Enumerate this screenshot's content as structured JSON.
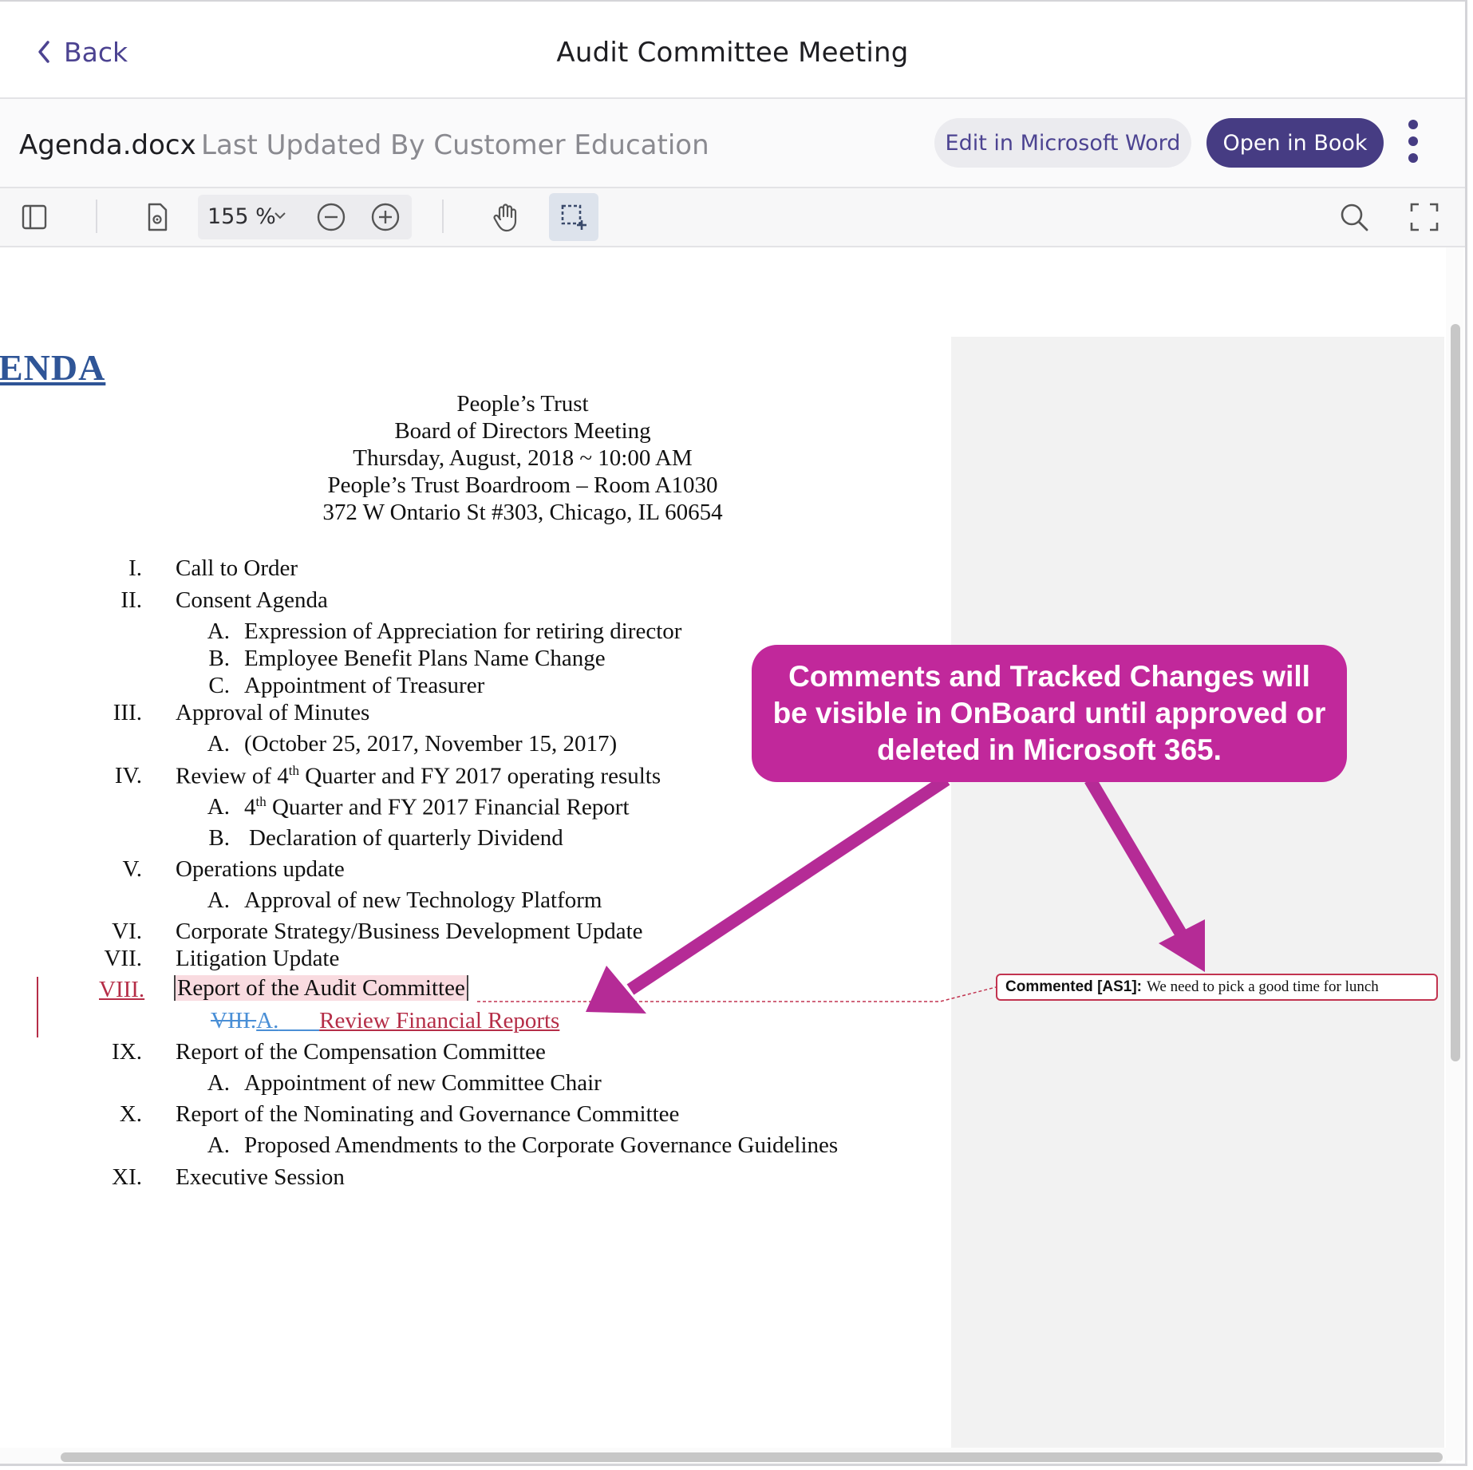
{
  "nav": {
    "back_label": "Back",
    "title": "Audit Committee Meeting"
  },
  "file": {
    "name": "Agenda.docx",
    "last_updated": "Last Updated By Customer Education",
    "edit_button": "Edit in Microsoft Word",
    "open_button": "Open in Book"
  },
  "toolbar": {
    "zoom": "155 %"
  },
  "document": {
    "heading": "ENDA",
    "header_lines": [
      "People’s Trust",
      "Board of Directors Meeting",
      "Thursday, August, 2018 ~ 10:00 AM",
      "People’s Trust Boardroom – Room A1030",
      "372 W Ontario St #303, Chicago, IL 60654"
    ],
    "items": {
      "i1": {
        "num": "I.",
        "text": "Call to Order"
      },
      "i2": {
        "num": "II.",
        "text": "Consent Agenda"
      },
      "i2a": {
        "num": "A.",
        "text": "Expression of Appreciation for retiring director"
      },
      "i2b": {
        "num": "B.",
        "text": "Employee Benefit Plans Name Change"
      },
      "i2c": {
        "num": "C.",
        "text": "Appointment of Treasurer"
      },
      "i3": {
        "num": "III.",
        "text": "Approval of Minutes"
      },
      "i3a": {
        "num": "A.",
        "text": "(October 25, 2017, November 15, 2017)"
      },
      "i4": {
        "num": "IV.",
        "pre": "Review of 4",
        "sup": "th",
        "post": " Quarter and FY 2017 operating results"
      },
      "i4a": {
        "num": "A.",
        "pre": "4",
        "sup": "th",
        "post": " Quarter and FY 2017 Financial Report"
      },
      "i4b": {
        "num": "B.",
        "text": "Declaration of quarterly Dividend"
      },
      "i5": {
        "num": "V.",
        "text": "Operations update"
      },
      "i5a": {
        "num": "A.",
        "text": "Approval of new Technology Platform"
      },
      "i6": {
        "num": "VI.",
        "text": "Corporate Strategy/Business Development Update"
      },
      "i7": {
        "num": "VII.",
        "text": "Litigation Update"
      },
      "i8": {
        "num": "VIII.",
        "text": "Report of the Audit Committee"
      },
      "i8a": {
        "deleted": "VIII.",
        "inserted_num": "A.",
        "text": "Review Financial Reports"
      },
      "i9": {
        "num": "IX.",
        "text": "Report of the Compensation Committee"
      },
      "i9a": {
        "num": "A.",
        "text": "Appointment of new Committee Chair"
      },
      "i10": {
        "num": "X.",
        "text": "Report of the Nominating and Governance Committee"
      },
      "i10a": {
        "num": "A.",
        "text": "Proposed Amendments to the Corporate Governance Guidelines"
      },
      "i11": {
        "num": "XI.",
        "text": "Executive Session"
      }
    }
  },
  "comment": {
    "tag": "Commented [AS1]:",
    "text": "We need to pick a good time for lunch"
  },
  "annotation": {
    "text": "Comments and Tracked Changes will be visible in OnBoard until approved or deleted in Microsoft 365."
  },
  "colors": {
    "brand": "#463c83",
    "tracked_change": "#b52d47",
    "inserted": "#4a8fd6",
    "callout": "#c1289b"
  }
}
